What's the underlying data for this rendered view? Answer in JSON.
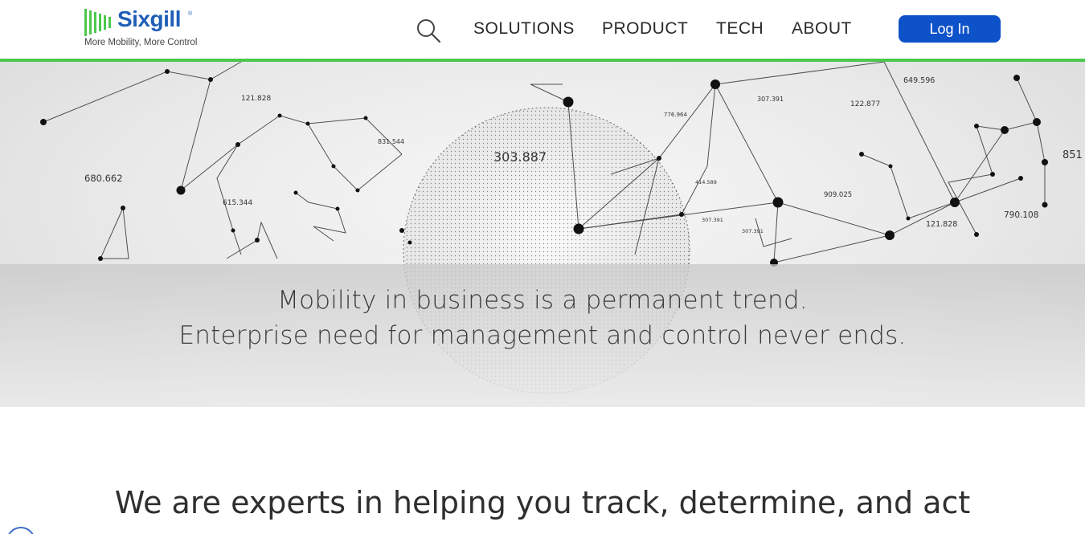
{
  "brand": {
    "name": "Sixgill",
    "trademark": "®",
    "tagline": "More Mobility, More Control",
    "colors": {
      "primary_blue": "#1f5fb8",
      "green": "#4cc94c",
      "button_blue": "#0d52c9"
    }
  },
  "header": {
    "search_icon": "search-icon",
    "nav": [
      {
        "label": "SOLUTIONS"
      },
      {
        "label": "PRODUCT"
      },
      {
        "label": "TECH"
      },
      {
        "label": "ABOUT"
      }
    ],
    "login_label": "Log In"
  },
  "hero": {
    "line1": "Mobility in business is a permanent trend.",
    "line2": "Enterprise need for management and control never ends.",
    "graphic_labels": [
      "121.828",
      "680.662",
      "831.544",
      "615.344",
      "303.887",
      "776.964",
      "307.391",
      "122.877",
      "649.596",
      "909.025",
      "121.828",
      "790.108",
      "851",
      "414.589",
      "307.391",
      "307.391"
    ]
  },
  "intro": {
    "text": "We are experts in helping you track, determine, and act"
  }
}
